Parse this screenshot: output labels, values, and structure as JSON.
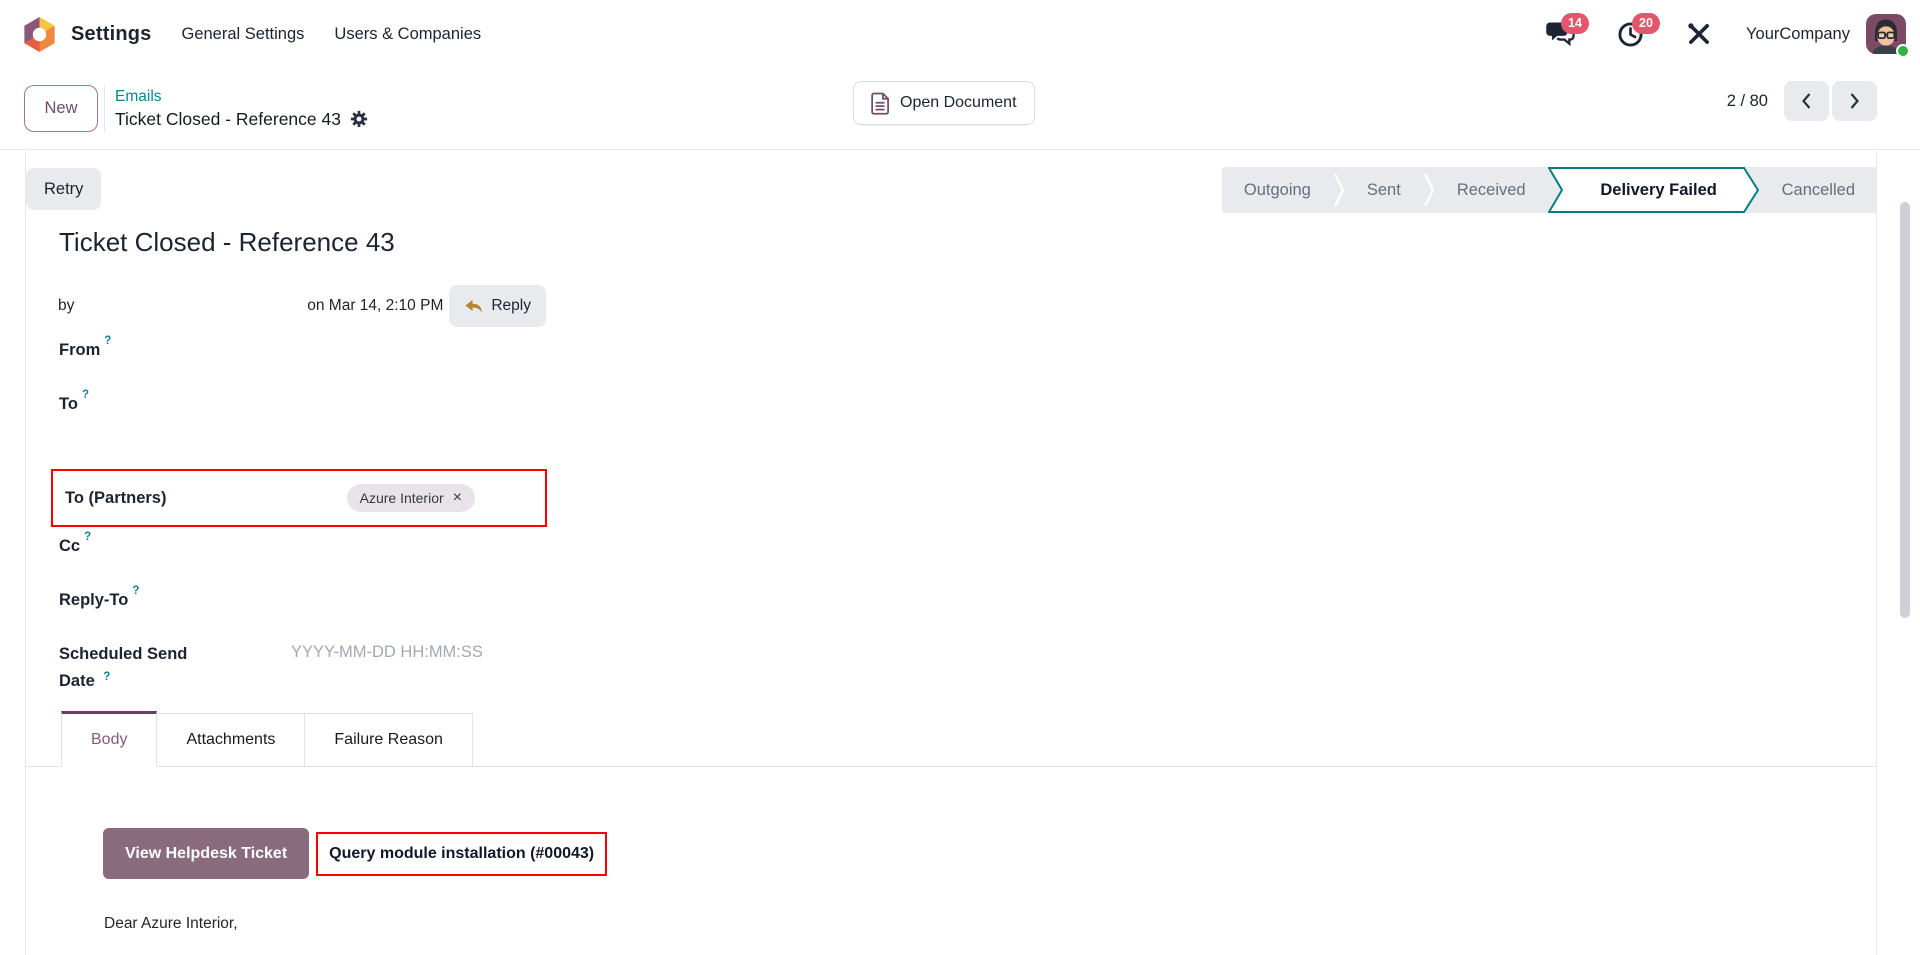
{
  "navbar": {
    "app_name": "Settings",
    "menu_items": [
      {
        "label": "General Settings"
      },
      {
        "label": "Users & Companies"
      }
    ],
    "messages_badge": "14",
    "activities_badge": "20",
    "company_name": "YourCompany"
  },
  "breadcrumb": {
    "new_button_label": "New",
    "parent_link": "Emails",
    "current_title": "Ticket Closed - Reference 43",
    "open_document_label": "Open Document",
    "pager_value": "2 / 80"
  },
  "statusbar": {
    "retry_button_label": "Retry",
    "stages": [
      {
        "label": "Outgoing",
        "state": "inactive"
      },
      {
        "label": "Sent",
        "state": "inactive"
      },
      {
        "label": "Received",
        "state": "inactive"
      },
      {
        "label": "Delivery Failed",
        "state": "active"
      },
      {
        "label": "Cancelled",
        "state": "inactive"
      }
    ]
  },
  "form": {
    "title": "Ticket Closed - Reference 43",
    "sender_prefix": "by",
    "sent_date": "on Mar 14, 2:10 PM",
    "reply_button_label": "Reply",
    "help_marker": "?",
    "fields": {
      "from_label": "From",
      "to_label": "To",
      "cc_label": "Cc",
      "reply_to_label": "Reply-To",
      "to_partners_label": "To (Partners)",
      "scheduled_line1": "Scheduled Send",
      "scheduled_line2": "Date",
      "scheduled_placeholder": "YYYY-MM-DD HH:MM:SS"
    },
    "to_partners_tag": {
      "label": "Azure Interior",
      "remove_icon": "×"
    }
  },
  "tabs": [
    {
      "label": "Body",
      "active": true
    },
    {
      "label": "Attachments",
      "active": false
    },
    {
      "label": "Failure Reason",
      "active": false
    }
  ],
  "email_body": {
    "view_ticket_button_label": "View Helpdesk Ticket",
    "subject_reference": "Query module installation (#00043)",
    "greeting": "Dear Azure Interior,"
  },
  "icons": {
    "app_logo": "odoo-cube",
    "messages": "chat-bubbles",
    "activities": "clock",
    "tools": "crossed-tools",
    "open_document": "document-outline",
    "title_action": "gear",
    "pager_prev": "chevron-left",
    "pager_next": "chevron-right",
    "reply": "reply-arrow",
    "tag_remove": "close-x"
  },
  "colors": {
    "accent_teal": "#017e84",
    "link_teal": "#0c8490",
    "brand_purple": "#714b67",
    "primary_button": "#8a6b7d",
    "active_tab_bar": "#6b3e5e",
    "badge_red": "#e4566a",
    "annotation_red": "#ff0000",
    "gray_button": "#e8eaee",
    "muted_text": "#65707c",
    "placeholder_gray": "#a3a9b1",
    "online_green": "#2fb344"
  }
}
